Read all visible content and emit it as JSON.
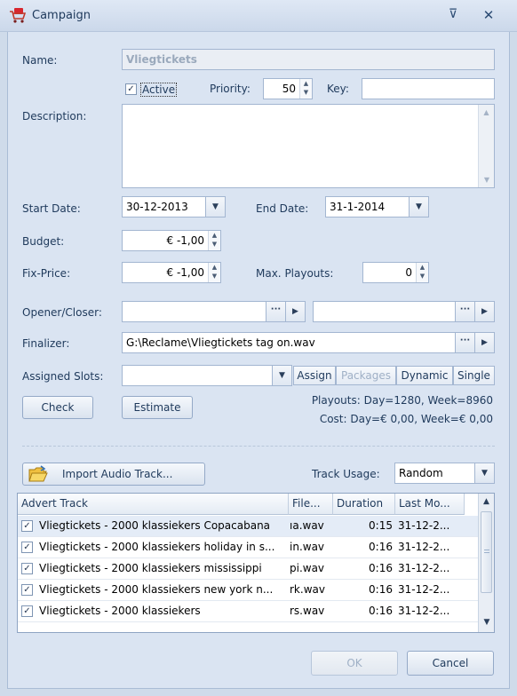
{
  "window": {
    "title": "Campaign",
    "pin_glyph": "⊽",
    "close_glyph": "✕"
  },
  "form": {
    "name_label": "Name:",
    "name_value": "Vliegtickets",
    "active_label": "Active",
    "active_checked": true,
    "priority_label": "Priority:",
    "priority_value": "50",
    "key_label": "Key:",
    "key_value": "",
    "description_label": "Description:",
    "description_value": "",
    "start_date_label": "Start Date:",
    "start_date_value": "30-12-2013",
    "end_date_label": "End Date:",
    "end_date_value": "31-1-2014",
    "budget_label": "Budget:",
    "budget_value": "€ -1,00",
    "fix_price_label": "Fix-Price:",
    "fix_price_value": "€ -1,00",
    "max_playouts_label": "Max. Playouts:",
    "max_playouts_value": "0",
    "opener_closer_label": "Opener/Closer:",
    "opener_value": "",
    "closer_value": "",
    "finalizer_label": "Finalizer:",
    "finalizer_value": "G:\\Reclame\\Vliegtickets tag on.wav",
    "assigned_slots_label": "Assigned Slots:",
    "assigned_slots_value": "",
    "slot_buttons": [
      "Assign",
      "Packages",
      "Dynamic",
      "Single"
    ],
    "check_label": "Check",
    "estimate_label": "Estimate",
    "playouts_text": "Playouts: Day=1280, Week=8960",
    "cost_text": "Cost: Day=€ 0,00, Week=€ 0,00"
  },
  "tracks": {
    "import_label": "Import Audio Track...",
    "usage_label": "Track Usage:",
    "usage_value": "Random",
    "columns": [
      "Advert Track",
      "File...",
      "Duration",
      "Last Mo..."
    ],
    "rows": [
      {
        "checked": true,
        "name": "Vliegtickets - 2000 klassiekers Copacabana",
        "file": "ıa.wav",
        "duration": "0:15",
        "last": "31-12-2..."
      },
      {
        "checked": true,
        "name": "Vliegtickets - 2000 klassiekers holiday in s...",
        "file": "in.wav",
        "duration": "0:16",
        "last": "31-12-2..."
      },
      {
        "checked": true,
        "name": "Vliegtickets - 2000 klassiekers mississippi",
        "file": "pi.wav",
        "duration": "0:16",
        "last": "31-12-2..."
      },
      {
        "checked": true,
        "name": "Vliegtickets - 2000 klassiekers new york n...",
        "file": "rk.wav",
        "duration": "0:16",
        "last": "31-12-2..."
      },
      {
        "checked": true,
        "name": "Vliegtickets - 2000 klassiekers",
        "file": "rs.wav",
        "duration": "0:16",
        "last": "31-12-2..."
      }
    ]
  },
  "footer": {
    "ok_label": "OK",
    "cancel_label": "Cancel"
  },
  "colors": {
    "accent": "#1e395b",
    "window_bg": "#dae4f2",
    "selected_row": "#e4ecf7"
  }
}
